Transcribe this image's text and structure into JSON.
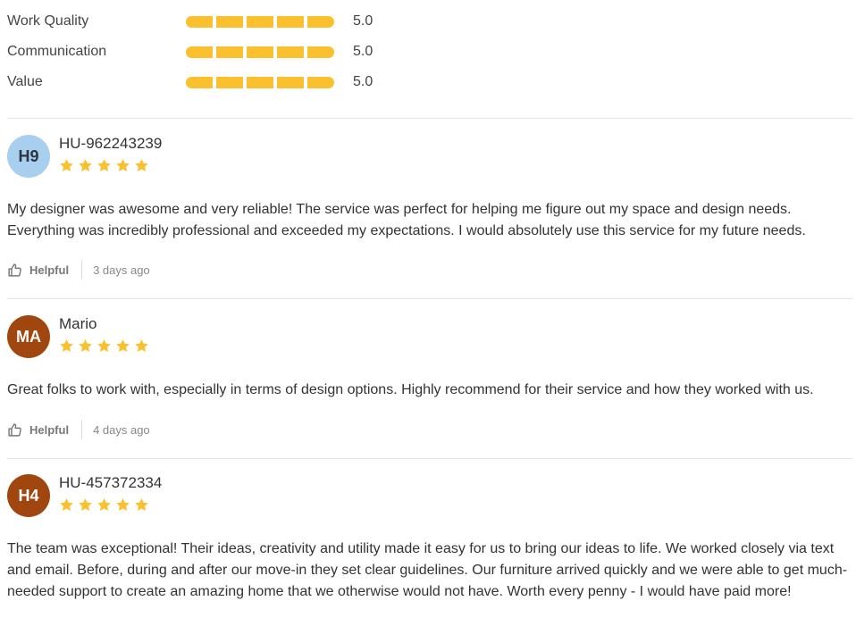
{
  "ratings": [
    {
      "label": "Work Quality",
      "value_text": "5.0",
      "value": 5.0,
      "max": 5
    },
    {
      "label": "Communication",
      "value_text": "5.0",
      "value": 5.0,
      "max": 5
    },
    {
      "label": "Value",
      "value_text": "5.0",
      "value": 5.0,
      "max": 5
    }
  ],
  "colors": {
    "star": "#fbc02d",
    "bar": "#fbc02d",
    "avatar_blue": "#a8cfee",
    "avatar_brown": "#a0470f"
  },
  "reviews": [
    {
      "initials": "H9",
      "name": "HU-962243239",
      "stars": 5,
      "text": "My designer was awesome and very reliable! The service was perfect for helping me figure out my space and design needs. Everything was incredibly professional and exceeded my expectations.  I would absolutely use this service for my future needs.",
      "helpful_label": "Helpful",
      "time": "3 days ago"
    },
    {
      "initials": "MA",
      "name": "Mario",
      "stars": 5,
      "text": "Great folks to work with, especially in terms of design options. Highly recommend for their service and how they worked with us.",
      "helpful_label": "Helpful",
      "time": "4 days ago"
    },
    {
      "initials": "H4",
      "name": "HU-457372334",
      "stars": 5,
      "text": "The team was exceptional! Their ideas, creativity and utility made it easy for us to bring our ideas to life. We worked closely via text and email. Before, during and after our move-in they set clear guidelines. Our furniture arrived quickly and we were able to get much-needed support to create an amazing home that we otherwise would not have. Worth every penny - I would have paid more!"
    }
  ]
}
